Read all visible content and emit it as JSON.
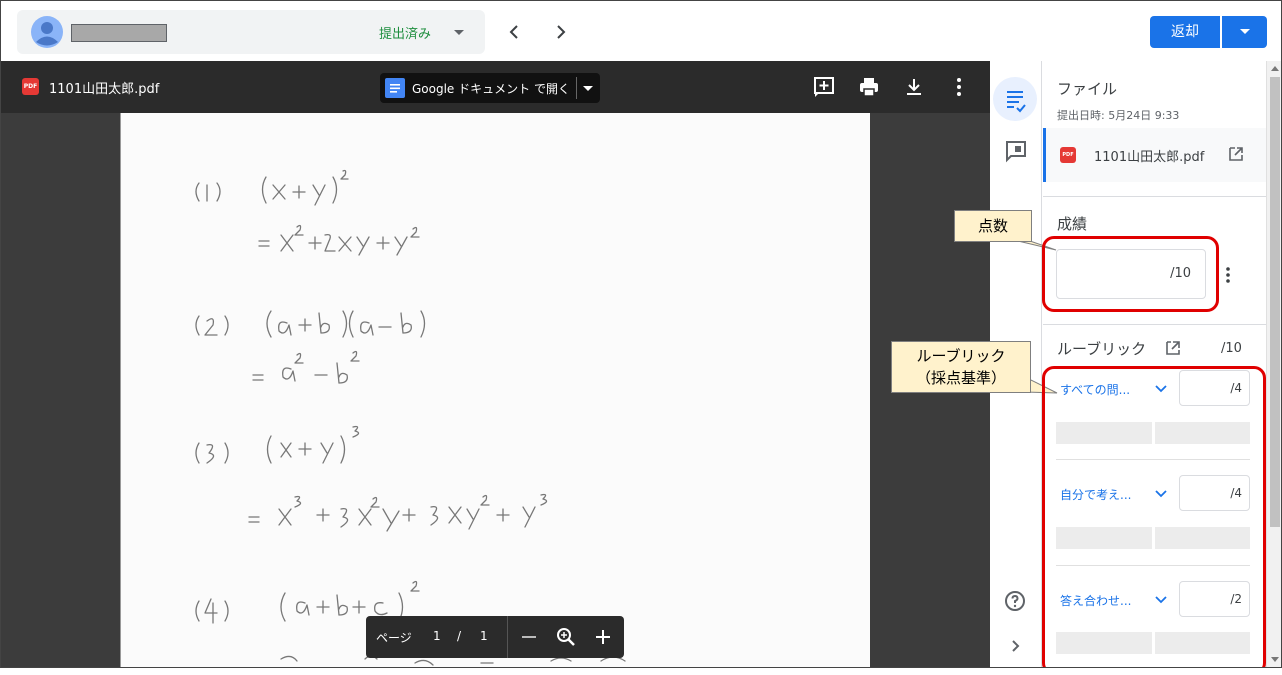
{
  "header": {
    "status": "提出済み",
    "return_label": "返却"
  },
  "viewer": {
    "file_title": "1101山田太郎.pdf",
    "pdf_badge": "PDF",
    "open_docs_label": "Google ドキュメント で開く",
    "icons": [
      "add-comment-icon",
      "print-icon",
      "download-icon",
      "more-vert-icon"
    ],
    "page_control": {
      "label": "ページ",
      "current": "1",
      "separator": "/",
      "total": "1"
    }
  },
  "rail": {
    "icons": [
      "file-list-icon",
      "comment-icon",
      "help-icon",
      "expand-icon"
    ]
  },
  "panel": {
    "files_heading": "ファイル",
    "submitted": "提出日時: 5月24日 9:33",
    "file_name": "1101山田太郎.pdf",
    "file_badge": "PDF",
    "grade_heading": "成績",
    "grade_max": "/10",
    "rubric_heading": "ルーブリック",
    "rubric_total": "/10",
    "criteria": [
      {
        "label": "すべての問...",
        "max": "/4"
      },
      {
        "label": "自分で考え...",
        "max": "/4"
      },
      {
        "label": "答え合わせ...",
        "max": "/2"
      }
    ]
  },
  "annotations": {
    "score_callout": "点数",
    "rubric_callout_line1": "ルーブリック",
    "rubric_callout_line2": "（採点基準）",
    "highlight_color": "#e00000",
    "callout_color": "#fff2cc"
  },
  "colors": {
    "accent": "#1a73e8",
    "status_green": "#1e8e3e",
    "viewer_bg": "#3c3c3c",
    "pdf_red": "#e53935"
  }
}
